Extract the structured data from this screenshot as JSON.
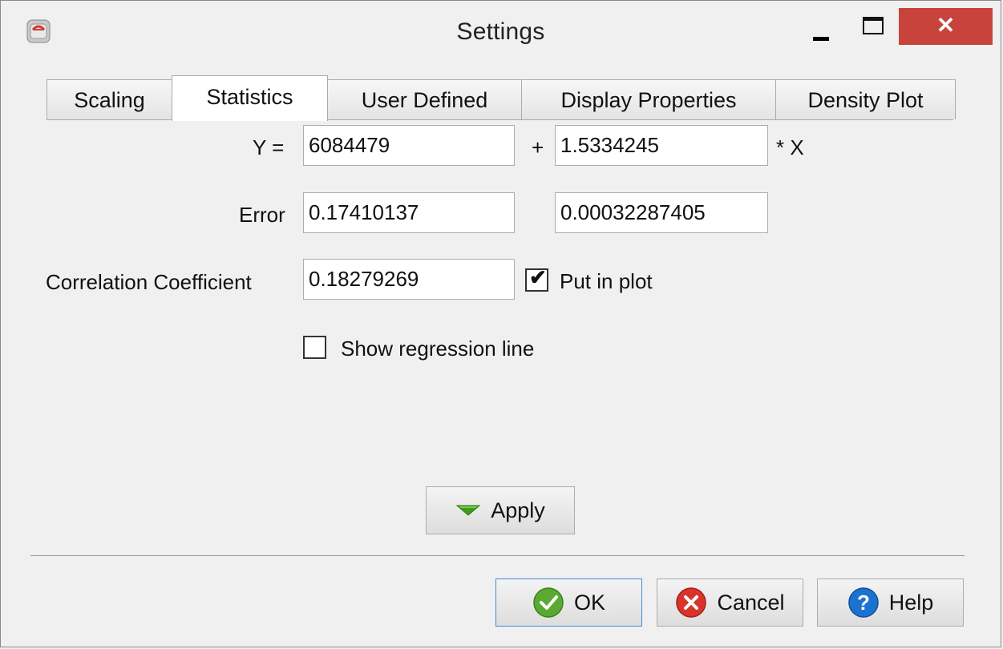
{
  "window": {
    "title": "Settings",
    "close_glyph": "✕",
    "icon": "app-icon"
  },
  "tabs": [
    {
      "label": "Scaling"
    },
    {
      "label": "Statistics",
      "active": true
    },
    {
      "label": "User Defined"
    },
    {
      "label": "Display Properties"
    },
    {
      "label": "Density Plot"
    }
  ],
  "form": {
    "y_label": "Y =",
    "intercept": "6084479",
    "plus_label": "+",
    "slope": "1.5334245",
    "x_label": "* X",
    "error_label": "Error",
    "error_intercept": "0.17410137",
    "error_slope": "0.00032287405",
    "correlation_label": "Correlation Coefficient",
    "correlation_value": "0.18279269",
    "put_in_plot_label": "Put in plot",
    "put_in_plot_checked": true,
    "show_regression_label": "Show regression line",
    "show_regression_checked": false,
    "apply_label": "Apply"
  },
  "buttons": {
    "ok": "OK",
    "cancel": "Cancel",
    "help": "Help"
  },
  "colors": {
    "close": "#c7433b",
    "ok_icon": "#5aaa32",
    "cancel_icon": "#d9342b",
    "help_icon": "#1b73d0",
    "apply_arrow": "#3f9c1c"
  }
}
